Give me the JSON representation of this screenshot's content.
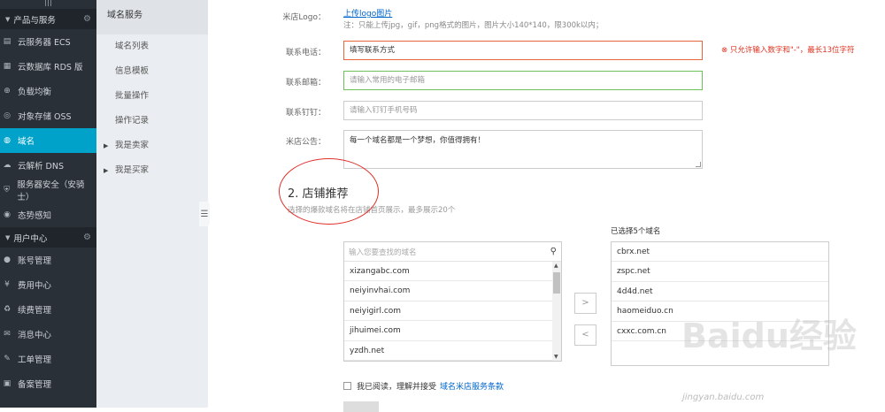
{
  "sidebar": {
    "groups": [
      {
        "label": "产品与服务",
        "items": [
          {
            "label": "云服务器 ECS",
            "icon": "server-icon"
          },
          {
            "label": "云数据库 RDS 版",
            "icon": "database-icon"
          },
          {
            "label": "负载均衡",
            "icon": "load-balance-icon"
          },
          {
            "label": "对象存储 OSS",
            "icon": "storage-icon"
          },
          {
            "label": "域名",
            "icon": "globe-icon",
            "active": true
          },
          {
            "label": "云解析 DNS",
            "icon": "dns-icon"
          },
          {
            "label": "服务器安全（安骑士）",
            "icon": "shield-icon"
          },
          {
            "label": "态势感知",
            "icon": "radar-icon"
          }
        ]
      },
      {
        "label": "用户中心",
        "items": [
          {
            "label": "账号管理",
            "icon": "user-icon"
          },
          {
            "label": "费用中心",
            "icon": "money-icon"
          },
          {
            "label": "续费管理",
            "icon": "renew-icon"
          },
          {
            "label": "消息中心",
            "icon": "message-icon"
          },
          {
            "label": "工单管理",
            "icon": "ticket-icon"
          },
          {
            "label": "备案管理",
            "icon": "record-icon"
          }
        ]
      }
    ]
  },
  "subnav": {
    "title": "域名服务",
    "items": [
      "域名列表",
      "信息模板",
      "批量操作",
      "操作记录"
    ],
    "expandable": [
      "我是卖家",
      "我是买家"
    ]
  },
  "form": {
    "logo_label": "米店Logo：",
    "logo_link": "上传logo图片",
    "logo_note": "注：只能上传jpg，gif，png格式的图片，图片大小140*140，限300k以内；",
    "phone_label": "联系电话：",
    "phone_value": "填写联系方式",
    "phone_error": "⊗ 只允许输入数字和\"-\"，最长13位字符",
    "email_label": "联系邮箱：",
    "email_placeholder": "请输入常用的电子邮箱",
    "dingtalk_label": "联系钉钉：",
    "dingtalk_placeholder": "请输入钉钉手机号码",
    "notice_label": "米店公告：",
    "notice_value": "每一个域名都是一个梦想，你值得拥有！"
  },
  "recommend": {
    "title": "2. 店铺推荐",
    "desc": "选择的爆款域名将在店铺首页展示，最多展示20个",
    "search_placeholder": "输入您要查找的域名",
    "available": [
      "xizangabc.com",
      "neiyinvhai.com",
      "neiyigirl.com",
      "jihuimei.com",
      "yzdh.net"
    ],
    "move_right": ">",
    "move_left": "<",
    "selected_title": "已选择5个域名",
    "selected": [
      "cbrx.net",
      "zspc.net",
      "4d4d.net",
      "haomeiduo.cn",
      "cxxc.com.cn"
    ]
  },
  "agreement": {
    "text": "我已阅读，理解并接受",
    "link": "域名米店服务条款"
  },
  "watermark": {
    "logo": "Baidu经验",
    "url": "jingyan.baidu.com"
  },
  "colors": {
    "sidebar_bg": "#293038",
    "active": "#00a2ca",
    "error": "#e0301e",
    "valid": "#6fbf5a",
    "link": "#0066cc"
  }
}
